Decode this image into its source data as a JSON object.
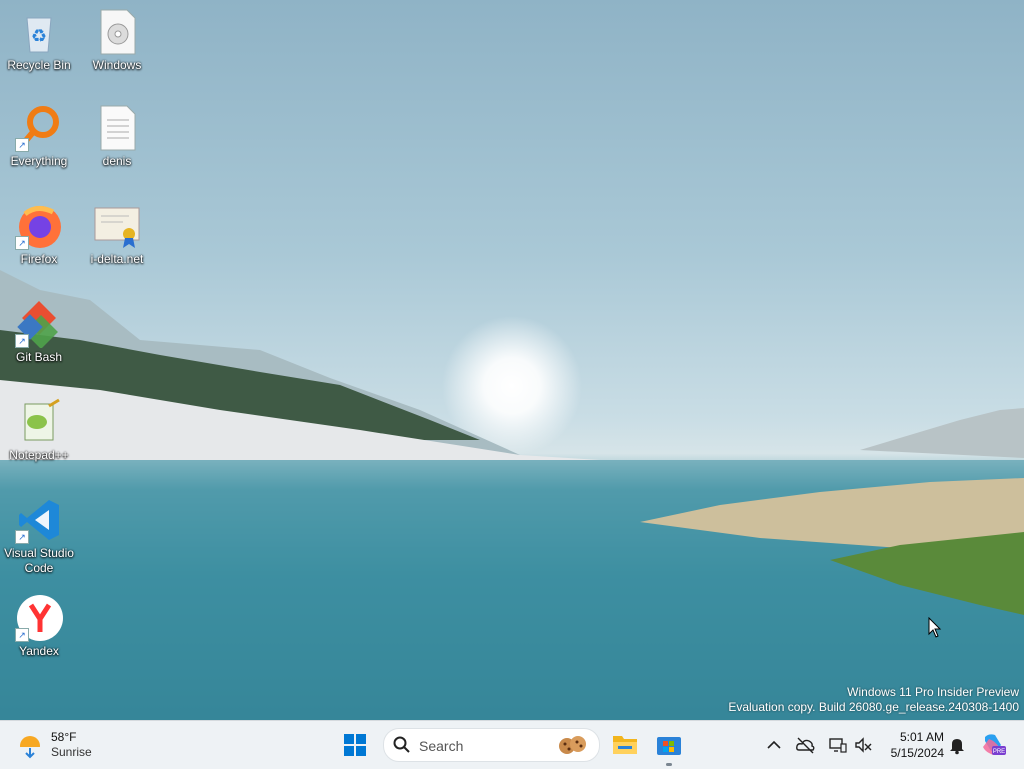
{
  "desktop": {
    "icons": [
      {
        "label": "Recycle Bin",
        "icon": "recycle-bin-icon"
      },
      {
        "label": "Windows",
        "icon": "disc-file-icon"
      },
      {
        "label": "Everything",
        "icon": "everything-search-icon"
      },
      {
        "label": "denis",
        "icon": "text-file-icon"
      },
      {
        "label": "Firefox",
        "icon": "firefox-icon"
      },
      {
        "label": "i-delta.net",
        "icon": "certificate-icon"
      },
      {
        "label": "Git Bash",
        "icon": "git-bash-icon"
      },
      {
        "label": "Notepad++",
        "icon": "notepadpp-icon"
      },
      {
        "label": "Visual Studio Code",
        "icon": "vscode-icon"
      },
      {
        "label": "Yandex",
        "icon": "yandex-browser-icon"
      }
    ],
    "watermark": {
      "line1": "Windows 11 Pro Insider Preview",
      "line2": "Evaluation copy. Build 26080.ge_release.240308-1400"
    }
  },
  "taskbar": {
    "weather": {
      "temp": "58°F",
      "condition": "Sunrise"
    },
    "search": {
      "placeholder": "Search"
    },
    "pinned": [
      "start-button",
      "file-explorer-icon",
      "microsoft-store-icon"
    ],
    "tray": {
      "time": "5:01 AM",
      "date": "5/15/2024",
      "icons": [
        "chevron-up-icon",
        "onedrive-offline-icon",
        "network-icon",
        "speaker-icon",
        "notification-bell-icon",
        "copilot-icon"
      ]
    }
  },
  "colors": {
    "taskbar": "#eef2f5",
    "accent": "#0067c0"
  }
}
